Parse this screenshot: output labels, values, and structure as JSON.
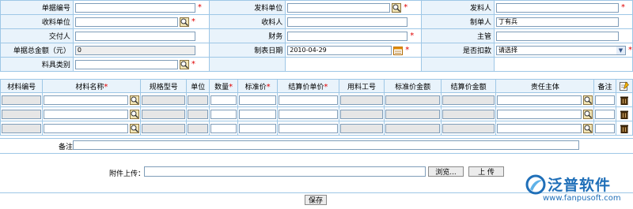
{
  "header": {
    "row1": {
      "doc_no_label": "单据编号",
      "issuer_unit_label": "发料单位",
      "issuer_label": "发料人"
    },
    "row2": {
      "receiver_unit_label": "收料单位",
      "receiver_label": "收料人",
      "preparer_label": "制单人",
      "preparer_value": "丁有兵"
    },
    "row3": {
      "deliverer_label": "交付人",
      "finance_label": "财务",
      "supervisor_label": "主管"
    },
    "row4": {
      "total_label": "单据总金额（元）",
      "total_value": "0",
      "date_label": "制表日期",
      "date_value": "2010-04-29",
      "deduct_label": "是否扣款",
      "deduct_value": "请选择"
    },
    "row5": {
      "category_label": "料具类别"
    }
  },
  "table": {
    "columns": [
      {
        "label": "材料编号",
        "required": false
      },
      {
        "label": "材料名称",
        "required": true
      },
      {
        "label": "规格型号",
        "required": false
      },
      {
        "label": "单位",
        "required": false
      },
      {
        "label": "数量",
        "required": true
      },
      {
        "label": "标准价",
        "required": true
      },
      {
        "label": "结算价单价",
        "required": true
      },
      {
        "label": "用料工号",
        "required": false
      },
      {
        "label": "标准价金额",
        "required": false
      },
      {
        "label": "结算价金额",
        "required": false
      },
      {
        "label": "责任主体",
        "required": false
      },
      {
        "label": "备注",
        "required": false
      }
    ],
    "required_mark": "*",
    "row_count": 3
  },
  "remark": {
    "label": "备注"
  },
  "attachment": {
    "label": "附件上传：",
    "browse_label": "浏览...",
    "upload_label": "上 传"
  },
  "save_label": "保存",
  "logo": {
    "brand": "泛普软件",
    "url": "www.fanpusoft.com"
  },
  "colors": {
    "border": "#9ec7e6",
    "label_bg": "#e9f3fb",
    "required": "#e00000",
    "logo_blue": "#1f6fb8"
  }
}
